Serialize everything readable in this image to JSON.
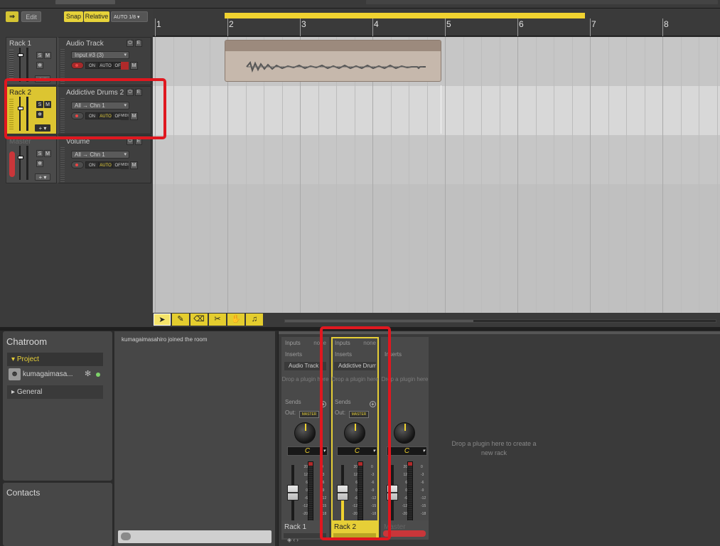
{
  "toolbar": {
    "edit_label": "Edit",
    "snap_label": "Snap",
    "relative_label": "Relative",
    "snap_value": "AUTO 1/8"
  },
  "tracks": [
    {
      "rack": "Rack 1",
      "name": "Audio Track",
      "input": "Input #3 (3)",
      "selected": false
    },
    {
      "rack": "Rack 2",
      "name": "Addictive Drums 2",
      "input": "All → Chn 1",
      "selected": true
    },
    {
      "rack": "Master",
      "name": "Volume",
      "input": "All → Chn 1",
      "selected": false
    }
  ],
  "track_buttons": {
    "solo": "S",
    "mute": "M",
    "fx": "✻",
    "plus": "+ ▾",
    "power": "⏻",
    "edit": "E",
    "monitor_on": "ON",
    "monitor_auto": "AUTO",
    "monitor_off": "OFF",
    "midi": "MIDI",
    "m": "M"
  },
  "ruler": {
    "bars": [
      "1",
      "2",
      "3",
      "4",
      "5",
      "6",
      "7",
      "8"
    ]
  },
  "tools": [
    "select-tool",
    "pencil-tool",
    "eraser-tool",
    "scissors-tool",
    "hand-tool",
    "note-tool"
  ],
  "chatroom": {
    "title": "Chatroom",
    "project_label": "Project",
    "user_name": "kumagaimasa...",
    "general_label": "General",
    "message": "kumagaimasahiro joined the room"
  },
  "contacts": {
    "title": "Contacts"
  },
  "mixer": {
    "labels": {
      "inputs": "Inputs",
      "inserts": "Inserts",
      "sends": "Sends",
      "out": "Out:",
      "none": "none",
      "drop_plugin": "Drop a plugin here",
      "master_badge": "MASTER",
      "pan": "C"
    },
    "strips": [
      {
        "name": "Rack 1",
        "insert": "Audio Track",
        "selected": false
      },
      {
        "name": "Rack 2",
        "insert": "Addictive Drums",
        "selected": true
      },
      {
        "name": "Master",
        "insert": "",
        "selected": false
      }
    ],
    "scale_left": [
      "20",
      "12",
      "6",
      "0",
      "-6",
      "-12",
      "-20"
    ],
    "scale_right": [
      "0",
      "-3",
      "-6",
      "-9",
      "-12",
      "-15",
      "-18"
    ],
    "drop_new_rack": "Drop a plugin here to create a new rack"
  },
  "colors": {
    "accent": "#e6cf37",
    "record": "#c9363a",
    "annotation": "#e0171f"
  }
}
